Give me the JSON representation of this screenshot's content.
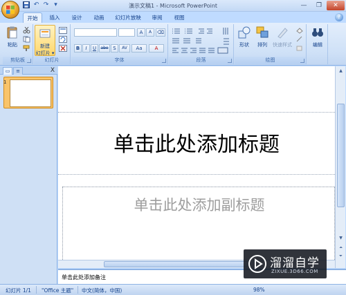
{
  "window": {
    "title": "演示文稿1 - Microsoft PowerPoint",
    "controls": [
      "—",
      "❐",
      "✕"
    ]
  },
  "qat": {
    "save": "💾",
    "undo": "↶",
    "redo": "↷",
    "more": "▾"
  },
  "tabs": [
    {
      "label": "开始",
      "active": true
    },
    {
      "label": "插入"
    },
    {
      "label": "设计"
    },
    {
      "label": "动画"
    },
    {
      "label": "幻灯片放映"
    },
    {
      "label": "审阅"
    },
    {
      "label": "视图"
    }
  ],
  "help": "?",
  "ribbon": {
    "clipboard": {
      "paste": "粘贴",
      "label": "剪贴板"
    },
    "slides": {
      "new_slide_line1": "新建",
      "new_slide_line2": "幻灯片 ▾",
      "label": "幻灯片"
    },
    "font": {
      "label": "字体",
      "grow": "A",
      "shrink": "A",
      "bold": "B",
      "italic": "I",
      "underline": "U",
      "strike": "abe",
      "shadow": "S",
      "spacing": "AV",
      "case": "Aa",
      "color": "A"
    },
    "paragraph": {
      "label": "段落"
    },
    "drawing": {
      "shapes": "形状",
      "arrange": "排列",
      "quick_styles": "快速样式",
      "label": "绘图"
    },
    "editing": {
      "label": "编辑"
    }
  },
  "outline_panel": {
    "tab1": "▭",
    "tab2": "≡",
    "close": "X",
    "slide_number": "1"
  },
  "slide": {
    "title_placeholder": "单击此处添加标题",
    "subtitle_placeholder": "单击此处添加副标题"
  },
  "notes": {
    "placeholder": "单击此处添加备注"
  },
  "status": {
    "slide_info": "幻灯片 1/1",
    "theme": "\"Office 主题\"",
    "language": "中文(简体，中国)",
    "zoom": "98%"
  },
  "watermark": {
    "name": "溜溜自学",
    "url": "ZIXUE.3D66.COM"
  },
  "colors": {
    "ribbon_bg": "#dbe8f9",
    "accent": "#15428b",
    "thumb_border": "#f2a53b"
  }
}
